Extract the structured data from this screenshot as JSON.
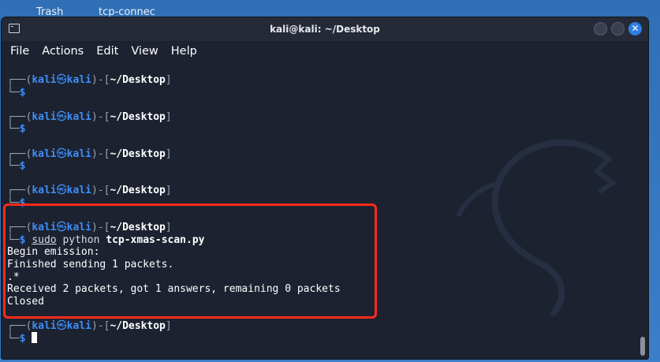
{
  "desktop": {
    "icon1_label": "Trash",
    "icon2_label": "tcp-connec"
  },
  "window": {
    "title": "kali@kali: ~/Desktop"
  },
  "menu": [
    "File",
    "Actions",
    "Edit",
    "View",
    "Help"
  ],
  "prompt": {
    "user": "kali",
    "host": "kali",
    "skull": "㉿",
    "path": "~/Desktop",
    "symbol": "$"
  },
  "cmd": {
    "sudo": "sudo",
    "python": "python",
    "script": "tcp-xmas-scan.py"
  },
  "output": [
    "Begin emission:",
    "Finished sending 1 packets.",
    ".*",
    "Received 2 packets, got 1 answers, remaining 0 packets",
    "Closed"
  ],
  "colors": {
    "accent": "#3e8ef7",
    "highlight": "#ff2a1c"
  }
}
